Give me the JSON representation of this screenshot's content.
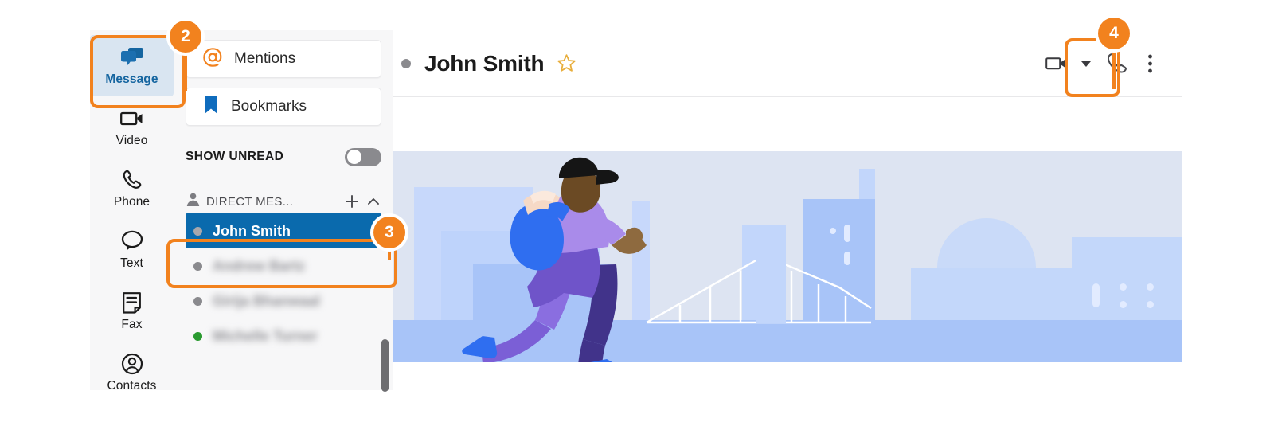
{
  "app": {
    "rail": {
      "items": [
        {
          "label": "Message",
          "icon": "message-icon",
          "active": true
        },
        {
          "label": "Video",
          "icon": "video-icon",
          "active": false
        },
        {
          "label": "Phone",
          "icon": "phone-icon",
          "active": false
        },
        {
          "label": "Text",
          "icon": "text-icon",
          "active": false
        },
        {
          "label": "Fax",
          "icon": "fax-icon",
          "active": false
        },
        {
          "label": "Contacts",
          "icon": "contacts-icon",
          "active": false
        }
      ]
    },
    "message_panel": {
      "buttons": [
        {
          "label": "Mentions",
          "icon": "at-icon"
        },
        {
          "label": "Bookmarks",
          "icon": "bookmark-icon"
        }
      ],
      "show_unread": {
        "label": "SHOW UNREAD",
        "toggle_state": "off"
      },
      "direct_messages": {
        "title": "DIRECT MES...",
        "add_label": "+",
        "collapse_icon": "chevron-up-icon",
        "people_icon": "person-icon",
        "items": [
          {
            "name": "John Smith",
            "presence": "away",
            "selected": true,
            "blurred": false
          },
          {
            "name": "Andrew Bartz",
            "presence": "away",
            "selected": false,
            "blurred": true
          },
          {
            "name": "Girija Bhanwaal",
            "presence": "away",
            "selected": false,
            "blurred": true
          },
          {
            "name": "Michelle Turner",
            "presence": "online",
            "selected": false,
            "blurred": true
          }
        ]
      }
    },
    "conversation": {
      "presence": "away",
      "title": "John Smith",
      "star_icon": "star-icon",
      "actions": [
        {
          "name": "video-call",
          "icon": "video-camera-icon"
        },
        {
          "name": "video-call-options",
          "icon": "caret-down-icon"
        },
        {
          "name": "phone-call",
          "icon": "phone-handset-icon"
        },
        {
          "name": "more-options",
          "icon": "more-vertical-icon"
        }
      ]
    }
  },
  "callouts": [
    {
      "number": "2",
      "target": "message-rail-button"
    },
    {
      "number": "3",
      "target": "direct-message-john-smith"
    },
    {
      "number": "4",
      "target": "phone-call-button"
    }
  ],
  "colors": {
    "accent_orange": "#f2821e",
    "selected_blue": "#0a6aad",
    "active_rail_bg": "#d9e5f1",
    "active_rail_text": "#1565a0",
    "online_green": "#2a9a30",
    "away_grey": "#8a8a8e",
    "sky": "#dde4f2",
    "ground": "#a8c4f8"
  },
  "illustration": {
    "name": "skateboarder-city-banner",
    "description": "Person with backpack riding a skateboard in front of a stylized blue city skyline with a suspension bridge and domed building"
  }
}
